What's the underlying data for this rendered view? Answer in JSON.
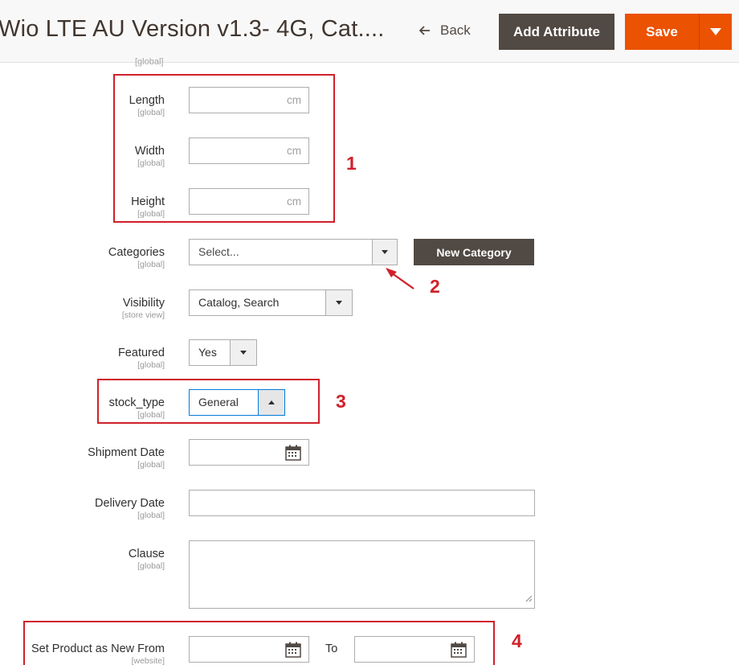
{
  "header": {
    "title": "Wio LTE AU Version v1.3- 4G, Cat....",
    "back_label": "Back",
    "add_attribute_label": "Add Attribute",
    "save_label": "Save"
  },
  "top_clipped_scope": "[global]",
  "fields": {
    "length": {
      "label": "Length",
      "scope": "[global]",
      "value": "",
      "suffix": "cm"
    },
    "width": {
      "label": "Width",
      "scope": "[global]",
      "value": "",
      "suffix": "cm"
    },
    "height": {
      "label": "Height",
      "scope": "[global]",
      "value": "",
      "suffix": "cm"
    },
    "categories": {
      "label": "Categories",
      "scope": "[global]",
      "value": "Select...",
      "new_button_label": "New Category"
    },
    "visibility": {
      "label": "Visibility",
      "scope": "[store view]",
      "value": "Catalog, Search"
    },
    "featured": {
      "label": "Featured",
      "scope": "[global]",
      "value": "Yes"
    },
    "stock_type": {
      "label": "stock_type",
      "scope": "[global]",
      "value": "General"
    },
    "shipment_date": {
      "label": "Shipment Date",
      "scope": "[global]",
      "value": ""
    },
    "delivery_date": {
      "label": "Delivery Date",
      "scope": "[global]",
      "value": ""
    },
    "clause": {
      "label": "Clause",
      "scope": "[global]",
      "value": ""
    },
    "new_from": {
      "label": "Set Product as New From",
      "scope": "[website]",
      "to_label": "To",
      "from_value": "",
      "to_value": ""
    }
  },
  "annotations": [
    "1",
    "2",
    "3",
    "4"
  ],
  "colors": {
    "annotation": "#d0202a",
    "primary_button": "#eb5202",
    "secondary_button": "#514943",
    "focus_border": "#007bdb"
  },
  "icons": [
    "back-arrow-icon",
    "chevron-down-icon",
    "calendar-icon",
    "resize-handle-icon"
  ]
}
